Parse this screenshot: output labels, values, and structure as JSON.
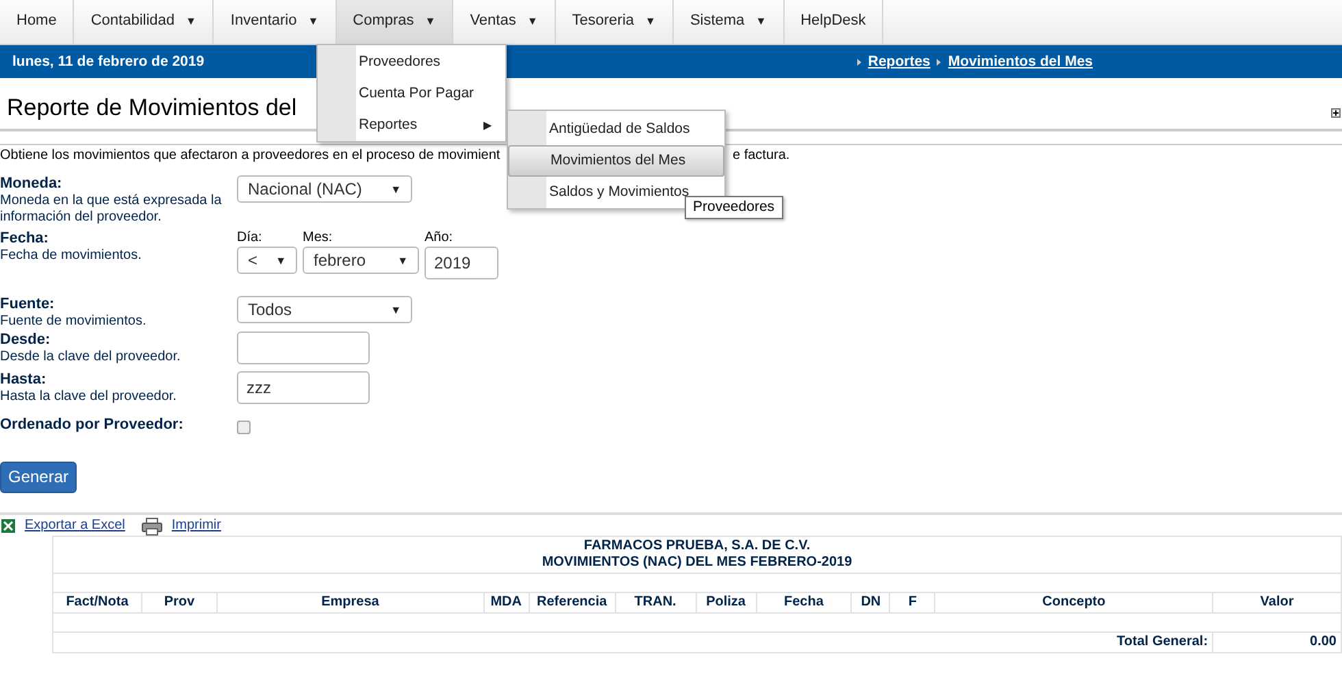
{
  "nav": {
    "items": [
      {
        "label": "Home",
        "expanded": false
      },
      {
        "label": "Contabilidad",
        "caret": "▼",
        "expanded": false
      },
      {
        "label": "Inventario",
        "caret": "▼",
        "expanded": false
      },
      {
        "label": "Compras",
        "caret": "▼",
        "expanded": true
      },
      {
        "label": "Ventas",
        "caret": "▼",
        "expanded": false
      },
      {
        "label": "Tesoreria",
        "caret": "▼",
        "expanded": false
      },
      {
        "label": "Sistema",
        "caret": "▼",
        "expanded": false
      },
      {
        "label": "HelpDesk",
        "expanded": false
      }
    ]
  },
  "header_bar": {
    "date": "lunes, 11 de febrero de 2019",
    "breadcrumb": [
      "Reportes",
      "Movimientos del Mes"
    ]
  },
  "page_title": "Reporte de Movimientos del",
  "description": [
    "Obtiene los movimientos que afectaron a proveedores en el proceso de movimient",
    "e factura."
  ],
  "form": {
    "fields": [
      {
        "kind": "select",
        "label": "Moneda:",
        "hint": "Moneda en la que está expresada la información del proveedor.",
        "value": "Nacional (NAC)",
        "caret": "▼"
      },
      {
        "kind": "date",
        "label": "Fecha:",
        "hint": "Fecha de movimientos.",
        "parts": [
          {
            "label": "Día:",
            "value": "<",
            "caret": "▼"
          },
          {
            "label": "Mes:",
            "value": "febrero",
            "caret": "▼"
          },
          {
            "label": "Año:",
            "value": "2019"
          }
        ]
      },
      {
        "kind": "select",
        "label": "Fuente:",
        "hint": "Fuente de movimientos.",
        "value": "Todos",
        "caret": "▼"
      },
      {
        "kind": "text",
        "label": "Desde:",
        "hint": "Desde la clave del proveedor."
      },
      {
        "kind": "text",
        "label": "Hasta:",
        "hint": "Hasta la clave del proveedor.",
        "value": "zzz"
      },
      {
        "kind": "checkbox",
        "label": "Ordenado por Proveedor:",
        "checked": false
      }
    ],
    "submit": "Generar"
  },
  "compras_menu": {
    "items": [
      {
        "label": "Proveedores"
      },
      {
        "label": "Cuenta Por Pagar"
      },
      {
        "label": "Reportes",
        "submenu_arrow": "▶"
      }
    ]
  },
  "reportes_submenu": {
    "items": [
      {
        "label": "Antigüedad de Saldos",
        "selected": false
      },
      {
        "label": "Movimientos del Mes",
        "selected": true
      },
      {
        "label": "Saldos y Movimientos",
        "selected": false
      }
    ]
  },
  "tooltip": "Proveedores",
  "report": {
    "links": [
      "Exportar a Excel",
      "Imprimir"
    ],
    "company": "FARMACOS PRUEBA, S.A. DE C.V.",
    "subtitle": "MOVIMIENTOS (NAC) DEL MES FEBRERO-2019",
    "columns": [
      "Fact/Nota",
      "Prov",
      "Empresa",
      "MDA",
      "Referencia",
      "TRAN.",
      "Poliza",
      "Fecha",
      "DN",
      "F",
      "Concepto",
      "Valor"
    ],
    "total_label": "Total General:",
    "total_value": "0.00"
  }
}
